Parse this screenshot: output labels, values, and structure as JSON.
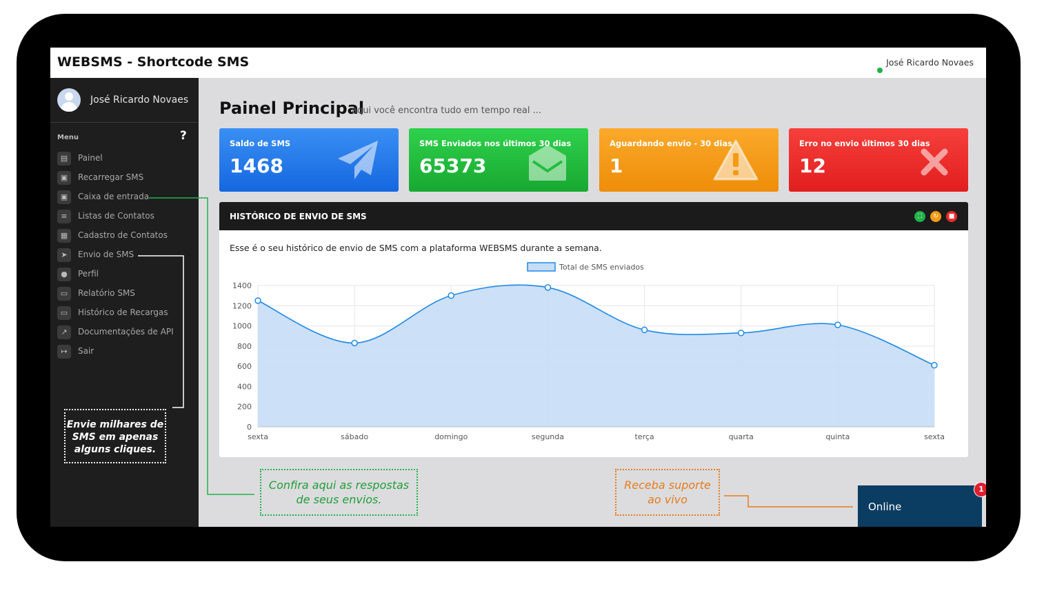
{
  "app": {
    "title": "WEBSMS - Shortcode SMS",
    "user": "José Ricardo Novaes"
  },
  "sidebar": {
    "profile_name": "José Ricardo Novaes",
    "menu_title": "Menu",
    "help": "?",
    "items": [
      {
        "label": "Painel",
        "icon": "chart-icon"
      },
      {
        "label": "Recarregar SMS",
        "icon": "cart-icon"
      },
      {
        "label": "Caixa de entrada",
        "icon": "inbox-icon"
      },
      {
        "label": "Listas de Contatos",
        "icon": "list-icon"
      },
      {
        "label": "Cadastro de Contatos",
        "icon": "address-card-icon"
      },
      {
        "label": "Envio de SMS",
        "icon": "send-icon"
      },
      {
        "label": "Perfil",
        "icon": "user-icon"
      },
      {
        "label": "Relatório SMS",
        "icon": "file-icon"
      },
      {
        "label": "Histórico de Recargas",
        "icon": "receipt-icon"
      },
      {
        "label": "Documentações de API",
        "icon": "external-link-icon"
      },
      {
        "label": "Sair",
        "icon": "sign-out-icon"
      }
    ]
  },
  "main": {
    "title": "Painel Principal",
    "subtitle": "aqui você encontra tudo em tempo real ...",
    "cards": [
      {
        "label": "Saldo de SMS",
        "value": "1468",
        "icon": "paper-plane-icon",
        "color": "#1e74ea"
      },
      {
        "label": "SMS Enviados nos últimos 30 dias",
        "value": "65373",
        "icon": "envelope-icon",
        "color": "#22bd3e"
      },
      {
        "label": "Aguardando envio - 30 dias",
        "value": "1",
        "icon": "warning-icon",
        "color": "#f59a14"
      },
      {
        "label": "Erro no envio últimos 30 dias",
        "value": "12",
        "icon": "close-icon",
        "color": "#ec2d2b"
      }
    ],
    "panel": {
      "title": "HISTÓRICO DE ENVIO DE SMS",
      "description": "Esse é o seu histórico de envio de SMS com a plataforma WEBSMS durante a semana."
    }
  },
  "chart_data": {
    "type": "area",
    "categories": [
      "sexta",
      "sábado",
      "domingo",
      "segunda",
      "terça",
      "quarta",
      "quinta",
      "sexta"
    ],
    "series": [
      {
        "name": "Total de SMS enviados",
        "values": [
          1250,
          830,
          1300,
          1380,
          960,
          930,
          1010,
          610
        ]
      }
    ],
    "ylim": [
      0,
      1400
    ],
    "yticks": [
      "0",
      "200",
      "400",
      "600",
      "800",
      "1000",
      "1200",
      "1400"
    ],
    "legend": "top-center",
    "grid": true,
    "colors": {
      "line": "#1e88e5",
      "fill": "#c7ddf7"
    }
  },
  "callouts": {
    "sidebar": "Envie milhares de SMS em apenas alguns cliques.",
    "inbox": "Confira aqui as respostas de seus envios.",
    "support": "Receba suporte ao vivo"
  },
  "chat": {
    "label": "Online",
    "badge": "1"
  }
}
